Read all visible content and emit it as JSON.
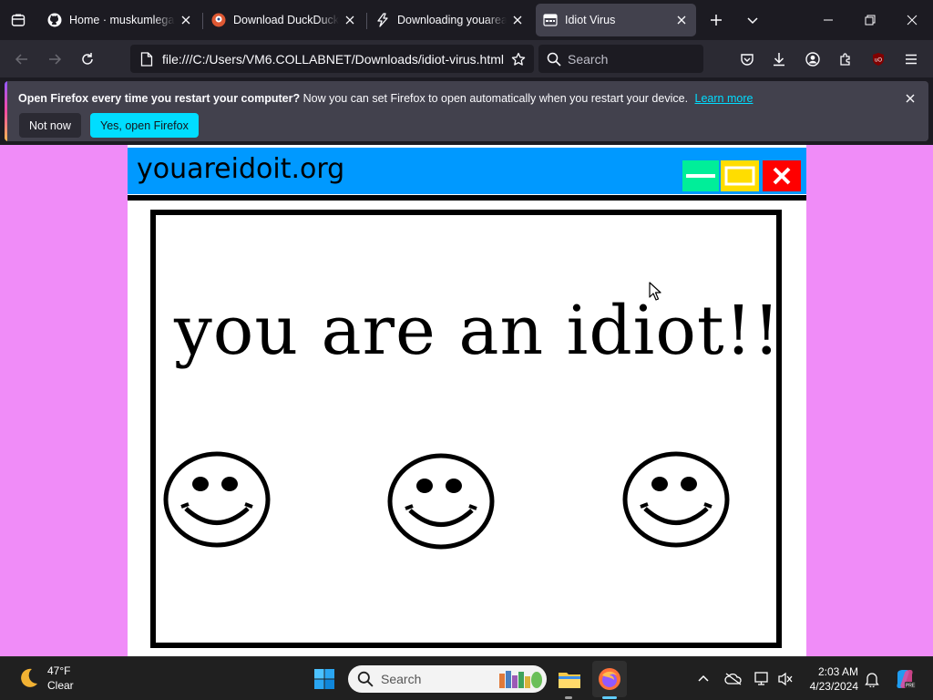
{
  "tabs": [
    {
      "title": "Home · muskumlegarr/...",
      "icon": "github-icon",
      "active": false
    },
    {
      "title": "Download DuckDuckGo",
      "icon": "duckduckgo-icon",
      "active": false
    },
    {
      "title": "Downloading youarean...",
      "icon": "downloading-icon",
      "active": false
    },
    {
      "title": "Idiot Virus",
      "icon": "page-icon",
      "active": true
    }
  ],
  "navbar": {
    "url": "file:///C:/Users/VM6.COLLABNET/Downloads/idiot-virus.html",
    "search_placeholder": "Search"
  },
  "notification": {
    "bold_text": "Open Firefox every time you restart your computer?",
    "text": "Now you can set Firefox to open automatically when you restart your device.",
    "link": "Learn more",
    "not_now": "Not now",
    "yes": "Yes, open Firefox"
  },
  "page": {
    "site_title": "youareidoit.org",
    "message": "you are an idiot!!!",
    "smiley_count": 3,
    "colors": {
      "background": "#f08cf8",
      "titlebar": "#0099ff",
      "minimize": "#00ee99",
      "maximize": "#ffdd00",
      "close": "#ff0000"
    }
  },
  "taskbar": {
    "weather_temp": "47°F",
    "weather_desc": "Clear",
    "search_placeholder": "Search",
    "time": "2:03 AM",
    "date": "4/23/2024",
    "pinned": [
      "windows-start-icon",
      "file-explorer-icon",
      "firefox-icon"
    ]
  }
}
